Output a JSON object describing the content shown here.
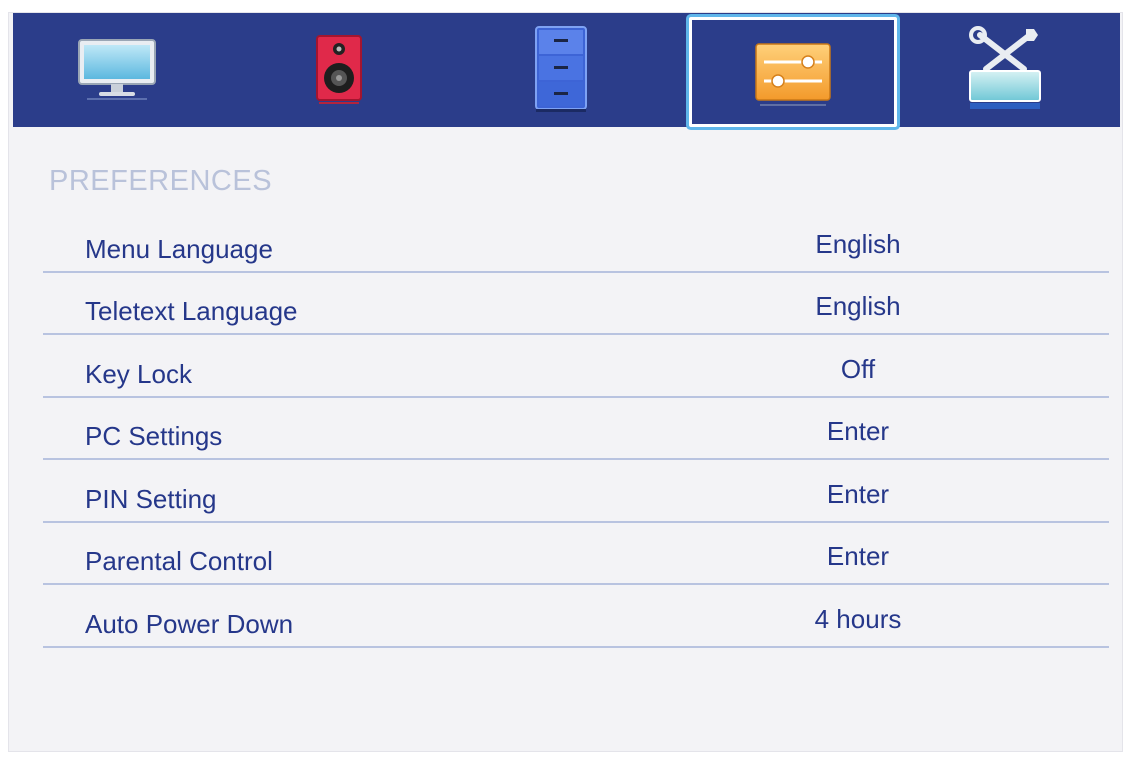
{
  "tabs": [
    {
      "icon": "monitor-icon",
      "active": false
    },
    {
      "icon": "speaker-icon",
      "active": false
    },
    {
      "icon": "cabinet-icon",
      "active": false
    },
    {
      "icon": "sliders-icon",
      "active": true
    },
    {
      "icon": "tools-icon",
      "active": false
    }
  ],
  "section": {
    "title": "PREFERENCES"
  },
  "rows": [
    {
      "label": "Menu Language",
      "value": "English"
    },
    {
      "label": "Teletext Language",
      "value": "English"
    },
    {
      "label": "Key Lock",
      "value": "Off"
    },
    {
      "label": "PC Settings",
      "value": "Enter"
    },
    {
      "label": "PIN Setting",
      "value": "Enter"
    },
    {
      "label": "Parental Control",
      "value": "Enter"
    },
    {
      "label": "Auto Power Down",
      "value": "4 hours"
    }
  ],
  "colors": {
    "tab_bar": "#2b3d8a",
    "active_outline": "#5fb6ea",
    "text": "#25378a",
    "section_title": "#b9c2da",
    "divider": "#b8c3e0"
  }
}
